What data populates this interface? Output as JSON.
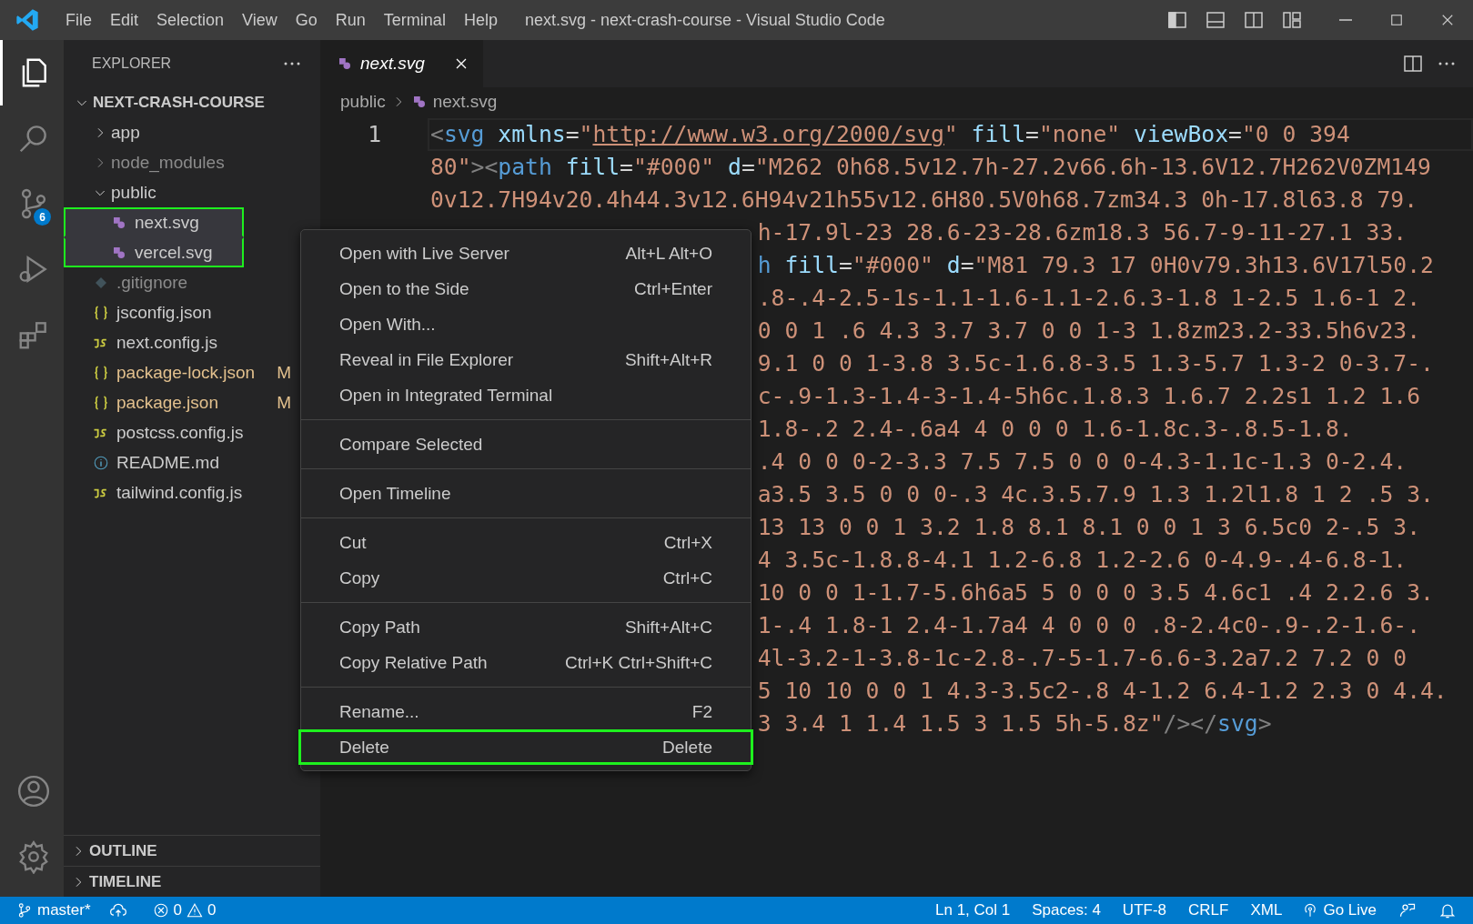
{
  "title_bar": {
    "menus": [
      "File",
      "Edit",
      "Selection",
      "View",
      "Go",
      "Run",
      "Terminal",
      "Help"
    ],
    "title": "next.svg - next-crash-course - Visual Studio Code"
  },
  "activity_bar": {
    "items": [
      {
        "kind": "files",
        "selected": true
      },
      {
        "kind": "search",
        "selected": false
      },
      {
        "kind": "source-control",
        "selected": false,
        "badge": "6"
      },
      {
        "kind": "run",
        "selected": false
      },
      {
        "kind": "extensions",
        "selected": false
      }
    ],
    "bottom": [
      {
        "kind": "account"
      },
      {
        "kind": "settings"
      }
    ]
  },
  "explorer": {
    "title": "EXPLORER",
    "root": {
      "name": "NEXT-CRASH-COURSE",
      "expanded": true,
      "children": [
        {
          "name": "app",
          "kind": "folder",
          "expanded": false,
          "ignored": false,
          "selected": false,
          "outlined": false
        },
        {
          "name": "node_modules",
          "kind": "folder",
          "expanded": false,
          "ignored": true,
          "selected": false,
          "outlined": false
        },
        {
          "name": "public",
          "kind": "folder",
          "expanded": true,
          "ignored": false,
          "selected": false,
          "outlined": false,
          "children": [
            {
              "name": "next.svg",
              "kind": "svg",
              "ignored": false,
              "selected": true,
              "outlined": true
            },
            {
              "name": "vercel.svg",
              "kind": "svg",
              "ignored": false,
              "selected": true,
              "outlined": true
            }
          ]
        },
        {
          "name": ".gitignore",
          "kind": "gitignore",
          "ignored": true,
          "selected": false,
          "outlined": false
        },
        {
          "name": "jsconfig.json",
          "kind": "json",
          "ignored": false,
          "selected": false,
          "outlined": false
        },
        {
          "name": "next.config.js",
          "kind": "js",
          "ignored": false,
          "selected": false,
          "outlined": false
        },
        {
          "name": "package-lock.json",
          "kind": "json",
          "ignored": false,
          "selected": false,
          "outlined": false,
          "git_status": "M"
        },
        {
          "name": "package.json",
          "kind": "json",
          "ignored": false,
          "selected": false,
          "outlined": false,
          "git_status": "M"
        },
        {
          "name": "postcss.config.js",
          "kind": "js",
          "ignored": false,
          "selected": false,
          "outlined": false
        },
        {
          "name": "README.md",
          "kind": "info",
          "ignored": false,
          "selected": false,
          "outlined": false
        },
        {
          "name": "tailwind.config.js",
          "kind": "js",
          "ignored": false,
          "selected": false,
          "outlined": false
        }
      ]
    },
    "sections": [
      {
        "label": "OUTLINE",
        "expanded": false
      },
      {
        "label": "TIMELINE",
        "expanded": false
      }
    ]
  },
  "tabs": [
    {
      "label": "next.svg",
      "selected": true,
      "preview": true
    }
  ],
  "breadcrumb": [
    "public",
    "next.svg"
  ],
  "editor": {
    "line_numbers": [
      "1"
    ],
    "lines": [
      {
        "partial": false,
        "segments": [
          {
            "kind": "bracket",
            "text": "<"
          },
          {
            "kind": "tag",
            "text": "svg"
          },
          {
            "kind": "attr",
            "text": " xmlns"
          },
          {
            "kind": "plain",
            "text": "="
          },
          {
            "kind": "string",
            "text": "\""
          },
          {
            "kind": "link",
            "text": "http://www.w3.org/2000/svg"
          },
          {
            "kind": "string",
            "text": "\""
          },
          {
            "kind": "attr",
            "text": " fill"
          },
          {
            "kind": "plain",
            "text": "="
          },
          {
            "kind": "string",
            "text": "\"none\""
          },
          {
            "kind": "attr",
            "text": " viewBox"
          },
          {
            "kind": "plain",
            "text": "="
          },
          {
            "kind": "string",
            "text": "\"0 0 394"
          }
        ]
      },
      {
        "partial": false,
        "segments": [
          {
            "kind": "string",
            "text": "80\""
          },
          {
            "kind": "bracket",
            "text": "><"
          },
          {
            "kind": "tag",
            "text": "path"
          },
          {
            "kind": "attr",
            "text": " fill"
          },
          {
            "kind": "plain",
            "text": "="
          },
          {
            "kind": "string",
            "text": "\"#000\""
          },
          {
            "kind": "attr",
            "text": " d"
          },
          {
            "kind": "plain",
            "text": "="
          },
          {
            "kind": "string",
            "text": "\"M262 0h68.5v12.7h-27.2v66.6h-13.6V12.7H262V0ZM149"
          }
        ]
      },
      {
        "partial": false,
        "segments": [
          {
            "kind": "string",
            "text": "0v12.7H94v20.4h44.3v12.6H94v21h55v12.6H80.5V0h68.7zm34.3 0h-17.8l63.8 79."
          }
        ]
      },
      {
        "partial": true,
        "segments": [
          {
            "kind": "string",
            "text": "h-17.9l-23 28.6-23-28.6zm18.3 56.7-9-11-27.1 33."
          }
        ]
      },
      {
        "partial": true,
        "segments": [
          {
            "kind": "tag",
            "text": "h"
          },
          {
            "kind": "attr",
            "text": " fill"
          },
          {
            "kind": "plain",
            "text": "="
          },
          {
            "kind": "string",
            "text": "\"#000\""
          },
          {
            "kind": "attr",
            "text": " d"
          },
          {
            "kind": "plain",
            "text": "="
          },
          {
            "kind": "string",
            "text": "\"M81 79.3 17 0H0v79.3h13.6V17l50.2"
          }
        ]
      },
      {
        "partial": true,
        "segments": [
          {
            "kind": "string",
            "text": ".8-.4-2.5-1s-1.1-1.6-1.1-2.6.3-1.8 1-2.5 1.6-1 2."
          }
        ]
      },
      {
        "partial": true,
        "segments": [
          {
            "kind": "string",
            "text": "0 0 1 .6 4.3 3.7 3.7 0 0 1-3 1.8zm23.2-33.5h6v23."
          }
        ]
      },
      {
        "partial": true,
        "segments": [
          {
            "kind": "string",
            "text": "9.1 0 0 1-3.8 3.5c-1.6.8-3.5 1.3-5.7 1.3-2 0-3.7-."
          }
        ]
      },
      {
        "partial": true,
        "segments": [
          {
            "kind": "string",
            "text": "c-.9-1.3-1.4-3-1.4-5h6c.1.8.3 1.6.7 2.2s1 1.2 1.6"
          }
        ]
      },
      {
        "partial": true,
        "segments": [
          {
            "kind": "string",
            "text": "1.8-.2 2.4-.6a4 4 0 0 0 1.6-1.8c.3-.8.5-1.8."
          }
        ]
      },
      {
        "partial": true,
        "segments": [
          {
            "kind": "string",
            "text": ".4 0 0 0-2-3.3 7.5 7.5 0 0 0-4.3-1.1c-1.3 0-2.4."
          }
        ]
      },
      {
        "partial": true,
        "segments": [
          {
            "kind": "string",
            "text": "a3.5 3.5 0 0 0-.3 4c.3.5.7.9 1.3 1.2l1.8 1 2 .5 3."
          }
        ]
      },
      {
        "partial": true,
        "segments": [
          {
            "kind": "string",
            "text": "13 13 0 0 1 3.2 1.8 8.1 8.1 0 0 1 3 6.5c0 2-.5 3."
          }
        ]
      },
      {
        "partial": true,
        "segments": [
          {
            "kind": "string",
            "text": "4 3.5c-1.8.8-4.1 1.2-6.8 1.2-2.6 0-4.9-.4-6.8-1."
          }
        ]
      },
      {
        "partial": true,
        "segments": [
          {
            "kind": "string",
            "text": "10 0 0 1-1.7-5.6h6a5 5 0 0 0 3.5 4.6c1 .4 2.2.6 3."
          }
        ]
      },
      {
        "partial": true,
        "segments": [
          {
            "kind": "string",
            "text": "1-.4 1.8-1 2.4-1.7a4 4 0 0 0 .8-2.4c0-.9-.2-1.6-."
          }
        ]
      },
      {
        "partial": true,
        "segments": [
          {
            "kind": "string",
            "text": "4l-3.2-1-3.8-1c-2.8-.7-5-1.7-6.6-3.2a7.2 7.2 0 0"
          }
        ]
      },
      {
        "partial": true,
        "segments": [
          {
            "kind": "string",
            "text": "5 10 10 0 0 1 4.3-3.5c2-.8 4-1.2 6.4-1.2 2.3 0 4.4."
          }
        ]
      },
      {
        "partial": true,
        "segments": [
          {
            "kind": "string",
            "text": "3 3.4 1 1.4 1.5 3 1.5 5h-5.8z\""
          },
          {
            "kind": "bracket",
            "text": "/></"
          },
          {
            "kind": "tag",
            "text": "svg"
          },
          {
            "kind": "bracket",
            "text": ">"
          }
        ]
      }
    ]
  },
  "context_menu": {
    "groups": [
      [
        {
          "label": "Open with Live Server",
          "shortcut": "Alt+L Alt+O",
          "outlined": false
        },
        {
          "label": "Open to the Side",
          "shortcut": "Ctrl+Enter",
          "outlined": false
        },
        {
          "label": "Open With...",
          "outlined": false
        },
        {
          "label": "Reveal in File Explorer",
          "shortcut": "Shift+Alt+R",
          "outlined": false
        },
        {
          "label": "Open in Integrated Terminal",
          "outlined": false
        }
      ],
      [
        {
          "label": "Compare Selected",
          "outlined": false
        }
      ],
      [
        {
          "label": "Open Timeline",
          "outlined": false
        }
      ],
      [
        {
          "label": "Cut",
          "shortcut": "Ctrl+X",
          "outlined": false
        },
        {
          "label": "Copy",
          "shortcut": "Ctrl+C",
          "outlined": false
        }
      ],
      [
        {
          "label": "Copy Path",
          "shortcut": "Shift+Alt+C",
          "outlined": false
        },
        {
          "label": "Copy Relative Path",
          "shortcut": "Ctrl+K Ctrl+Shift+C",
          "outlined": false
        }
      ],
      [
        {
          "label": "Rename...",
          "shortcut": "F2",
          "outlined": false
        },
        {
          "label": "Delete",
          "shortcut": "Delete",
          "outlined": true
        }
      ]
    ]
  },
  "status_bar": {
    "branch": "master*",
    "errors": "0",
    "warnings": "0",
    "right": [
      {
        "kind": "text",
        "label": "Ln 1, Col 1"
      },
      {
        "kind": "text",
        "label": "Spaces: 4"
      },
      {
        "kind": "text",
        "label": "UTF-8"
      },
      {
        "kind": "text",
        "label": "CRLF"
      },
      {
        "kind": "text",
        "label": "XML"
      },
      {
        "kind": "live",
        "label": "Go Live"
      },
      {
        "kind": "feedback"
      },
      {
        "kind": "bell"
      }
    ]
  }
}
